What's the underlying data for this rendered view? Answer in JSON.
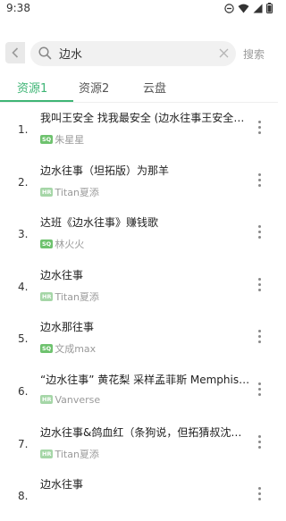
{
  "status_bar": {
    "time": "9:38"
  },
  "search": {
    "query": "边水",
    "button_label": "搜索"
  },
  "tabs": [
    {
      "label": "资源1",
      "active": true
    },
    {
      "label": "资源2",
      "active": false
    },
    {
      "label": "云盘",
      "active": false
    }
  ],
  "colors": {
    "accent": "#3eb575",
    "badge_sq": "#6ec26e",
    "badge_hr": "#a5d6a7"
  },
  "results": [
    {
      "index": "1.",
      "title": "我叫王安全 找我最安全 (边水往事王安全之…",
      "badge": "SQ",
      "artist": "朱星星"
    },
    {
      "index": "2.",
      "title": "边水往事（坦拓版）为那羊",
      "badge": "HR",
      "artist": "Titan夏添"
    },
    {
      "index": "3.",
      "title": "达班《边水往事》赚钱歌",
      "badge": "SQ",
      "artist": "林火火"
    },
    {
      "index": "4.",
      "title": "边水往事",
      "badge": "HR",
      "artist": "Titan夏添"
    },
    {
      "index": "5.",
      "title": "边水那往事",
      "badge": "SQ",
      "artist": "文成max"
    },
    {
      "index": "6.",
      "title": "“边水往事” 黄花梨 采样孟菲斯 Memphis Ty…",
      "badge": "HR",
      "artist": "Vanverse"
    },
    {
      "index": "7.",
      "title": "边水往事&鸽血红（条狗说，但拓猜叔沈星…",
      "badge": "HR",
      "artist": "Titan夏添"
    },
    {
      "index": "8.",
      "title": "边水往事",
      "badge": "",
      "artist": ""
    }
  ]
}
